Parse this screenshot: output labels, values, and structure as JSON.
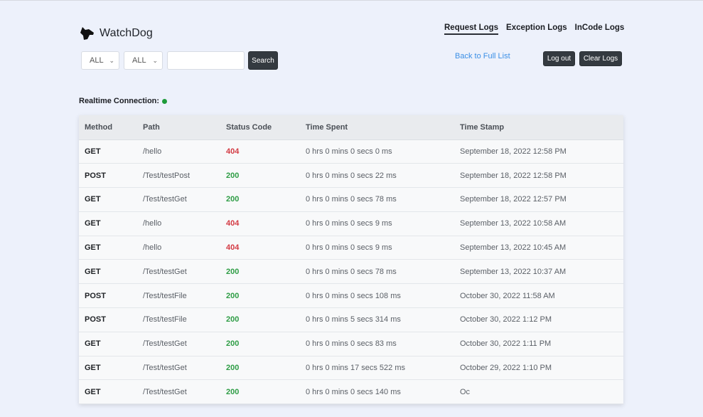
{
  "app": {
    "name": "WatchDog",
    "logo_icon": "dog-head-icon"
  },
  "nav": [
    {
      "label": "Request Logs",
      "active": true
    },
    {
      "label": "Exception Logs",
      "active": false
    },
    {
      "label": "InCode Logs",
      "active": false
    }
  ],
  "filters": {
    "method_select": "ALL",
    "status_select": "ALL",
    "search_value": "",
    "search_button": "Search"
  },
  "actions": {
    "back_link": "Back to Full List",
    "logout": "Log out",
    "clear_logs": "Clear Logs"
  },
  "realtime": {
    "label": "Realtime Connection:",
    "status_color": "#1e9b3a"
  },
  "colors": {
    "error": "#d33a43",
    "success": "#2e9d45",
    "link": "#3b8fe6",
    "dark_button": "#343a40"
  },
  "table": {
    "headers": [
      "Method",
      "Path",
      "Status Code",
      "Time Spent",
      "Time Stamp"
    ],
    "rows": [
      [
        "GET",
        "/hello",
        "404",
        "0 hrs 0 mins 0 secs 0 ms",
        "September 18, 2022 12:58 PM"
      ],
      [
        "POST",
        "/Test/testPost",
        "200",
        "0 hrs 0 mins 0 secs 22 ms",
        "September 18, 2022 12:58 PM"
      ],
      [
        "GET",
        "/Test/testGet",
        "200",
        "0 hrs 0 mins 0 secs 78 ms",
        "September 18, 2022 12:57 PM"
      ],
      [
        "GET",
        "/hello",
        "404",
        "0 hrs 0 mins 0 secs 9 ms",
        "September 13, 2022 10:58 AM"
      ],
      [
        "GET",
        "/hello",
        "404",
        "0 hrs 0 mins 0 secs 9 ms",
        "September 13, 2022 10:45 AM"
      ],
      [
        "GET",
        "/Test/testGet",
        "200",
        "0 hrs 0 mins 0 secs 78 ms",
        "September 13, 2022 10:37 AM"
      ],
      [
        "POST",
        "/Test/testFile",
        "200",
        "0 hrs 0 mins 0 secs 108 ms",
        "October 30, 2022 11:58 AM"
      ],
      [
        "POST",
        "/Test/testFile",
        "200",
        "0 hrs 0 mins 5 secs 314 ms",
        "October 30, 2022 1:12 PM"
      ],
      [
        "GET",
        "/Test/testGet",
        "200",
        "0 hrs 0 mins 0 secs 83 ms",
        "October 30, 2022 1:11 PM"
      ],
      [
        "GET",
        "/Test/testGet",
        "200",
        "0 hrs 0 mins 17 secs 522 ms",
        "October 29, 2022 1:10 PM"
      ],
      [
        "GET",
        "/Test/testGet",
        "200",
        "0 hrs 0 mins 0 secs 140 ms",
        "Oc"
      ]
    ]
  }
}
